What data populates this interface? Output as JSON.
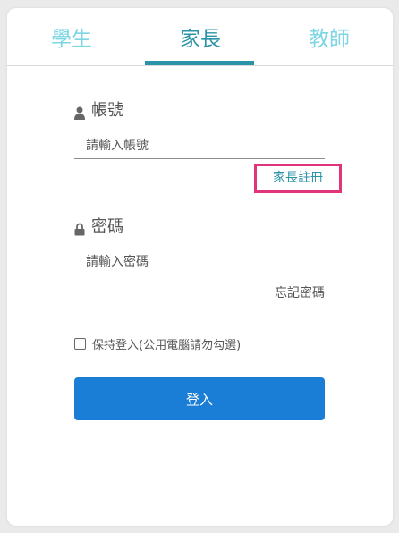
{
  "tabs": [
    {
      "label": "學生",
      "active": false
    },
    {
      "label": "家長",
      "active": true
    },
    {
      "label": "教師",
      "active": false
    }
  ],
  "account": {
    "label": "帳號",
    "icon": "user-icon",
    "placeholder": "請輸入帳號",
    "value": ""
  },
  "register_link": "家長註冊",
  "password": {
    "label": "密碼",
    "icon": "lock-icon",
    "placeholder": "請輸入密碼",
    "value": ""
  },
  "forgot_link": "忘記密碼",
  "remember": {
    "label": "保持登入(公用電腦請勿勾選)",
    "checked": false
  },
  "login_button": "登入",
  "colors": {
    "tab_active": "#2b93a8",
    "tab_inactive": "#7dd6e4",
    "highlight_border": "#e0357a",
    "button": "#1a7dd6"
  }
}
